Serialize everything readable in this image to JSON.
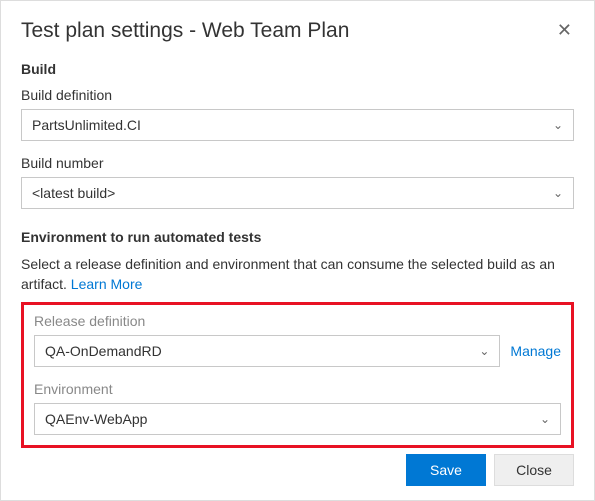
{
  "dialog": {
    "title": "Test plan settings - Web Team Plan"
  },
  "build": {
    "heading": "Build",
    "definition_label": "Build definition",
    "definition_value": "PartsUnlimited.CI",
    "number_label": "Build number",
    "number_value": "<latest build>"
  },
  "environment": {
    "heading": "Environment to run automated tests",
    "description": "Select a release definition and environment that can consume the selected build as an artifact. ",
    "learn_more": "Learn More",
    "release_label": "Release definition",
    "release_value": "QA-OnDemandRD",
    "manage": "Manage",
    "env_label": "Environment",
    "env_value": "QAEnv-WebApp"
  },
  "buttons": {
    "save": "Save",
    "close": "Close"
  }
}
